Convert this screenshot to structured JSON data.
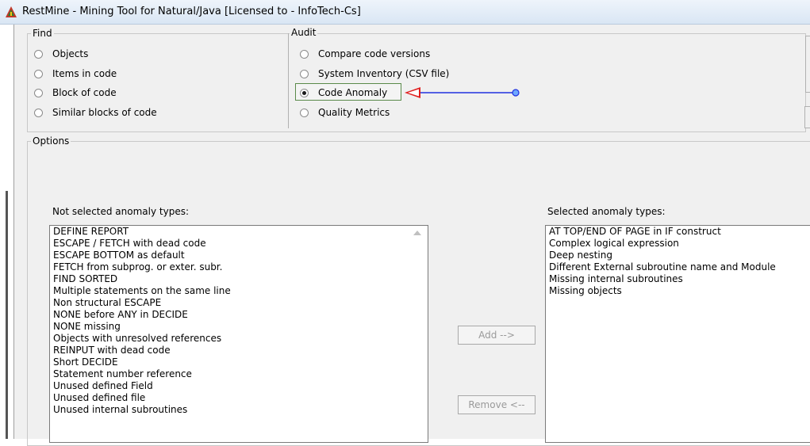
{
  "window": {
    "title": "RestMine - Mining Tool for Natural/Java [Licensed to  - InfoTech-Cs]"
  },
  "find_group": {
    "label": "Find",
    "options": [
      {
        "label": "Objects",
        "checked": false
      },
      {
        "label": "Items in code",
        "checked": false
      },
      {
        "label": "Block of code",
        "checked": false
      },
      {
        "label": "Similar blocks of code",
        "checked": false
      }
    ]
  },
  "audit_group": {
    "label": "Audit",
    "options": [
      {
        "label": "Compare code versions",
        "checked": false
      },
      {
        "label": "System Inventory (CSV file)",
        "checked": false
      },
      {
        "label": "Code Anomaly",
        "checked": true
      },
      {
        "label": "Quality Metrics",
        "checked": false
      }
    ]
  },
  "annotation": {
    "color": "#2030e0"
  },
  "options_group": {
    "label": "Options",
    "not_selected_label": "Not selected anomaly types:",
    "selected_label": "Selected anomaly types:",
    "not_selected_items": [
      "DEFINE REPORT",
      "ESCAPE / FETCH with dead code",
      "ESCAPE BOTTOM as default",
      "FETCH from subprog. or exter. subr.",
      "FIND SORTED",
      "Multiple statements on the same line",
      "Non structural ESCAPE",
      "NONE before ANY in DECIDE",
      "NONE missing",
      "Objects with unresolved references",
      "REINPUT with dead code",
      "Short DECIDE",
      "Statement number reference",
      "Unused defined Field",
      "Unused defined file",
      "Unused internal subroutines"
    ],
    "selected_items": [
      "AT TOP/END OF PAGE in IF construct",
      "Complex logical expression",
      "Deep nesting",
      "Different External subroutine name and Module",
      "Missing internal subroutines",
      "Missing objects"
    ],
    "add_label": "Add -->",
    "remove_label": "Remove <--"
  }
}
